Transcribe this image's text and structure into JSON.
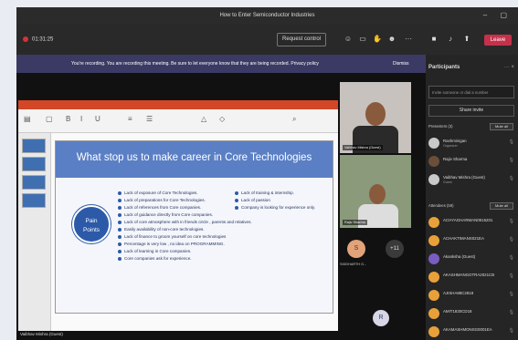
{
  "window": {
    "title": "How to Enter Semiconductor Industries",
    "controls": "– ▢"
  },
  "toolbar": {
    "timer": "01:31:25",
    "request_control": "Request control",
    "icons": [
      "people-icon",
      "chat-icon",
      "raise-hand-icon",
      "reactions-icon",
      "more-icon",
      "camera-icon",
      "mic-icon",
      "share-icon"
    ],
    "leave": "Leave",
    "leave_color": "#c4314b"
  },
  "banner": {
    "message": "You're recording. You are recording this meeting. Be sure to let everyone know that they are being recorded. Privacy policy",
    "dismiss": "Dismiss",
    "color": "#3b3a64"
  },
  "slide": {
    "title": "What stop us to make career in Core Technologies",
    "circle_line1": "Pain",
    "circle_line2": "Points",
    "bullets_left": [
      "Lack of exposure of Core Technologies.",
      "Lack of preparations for Core Technologies.",
      "Lack of references from Core companies.",
      "Lack of guidance directly from Core companies.",
      "Lack of core atmosphere with in friends circle , parents and relatives.",
      "Easily availability of non-core technologies.",
      "Lack of finance to groom yourself on core technologies",
      "Percentage is very low , no idea on PROGRAMMING.",
      "Lack of learning in Core companies.",
      "Core companies ask for experience."
    ],
    "bullets_right": [
      "Lack of training & internship.",
      "Lack of passion",
      "Company is looking for experience only."
    ],
    "accent": "#2d5aa8"
  },
  "presenter_label": "Vaibhav Mishra (Guest)",
  "tiles": {
    "tile1_name": "Vaibhav Mishra (Guest)",
    "tile2_name": "Rajiv Sharma",
    "avatar_letter": "S",
    "avatar_caption": "SIDDHARTH G...",
    "overflow": "+11",
    "avatar2_letter": "R"
  },
  "participants": {
    "title": "Participants",
    "controls": "··· ×",
    "invite_placeholder": "Invite someone or dial a number",
    "share_invite": "Share invite",
    "presenters_label": "Presenters (3)",
    "attendees_label": "Attendees (59)",
    "mute_all": "Mute all",
    "presenters": [
      {
        "name": "Rashminigan",
        "sub": "Organizer",
        "color": "#c9c9c9"
      },
      {
        "name": "Rajiv Sharma",
        "sub": "",
        "color": "#6b4e3a"
      },
      {
        "name": "Vaibhav Mishra (Guest)",
        "sub": "Guest",
        "color": "#c9c9c9"
      }
    ],
    "attendees": [
      {
        "name": "ACHYAGHARMAN0915201",
        "color": "#e8a13a"
      },
      {
        "name": "ACHAKTIMANS021EA",
        "color": "#e8a13a"
      },
      {
        "name": "Akanksha (Guest)",
        "color": "#7a5cc2"
      },
      {
        "name": "AKASHMANGOTRA2021CB",
        "color": "#e8a13a"
      },
      {
        "name": "AJISHA88C2818",
        "color": "#e8a13a"
      },
      {
        "name": "AMIT1830CD18",
        "color": "#e8a13a"
      },
      {
        "name": "AKAMASHMONSG0001EA",
        "color": "#e8a13a"
      }
    ]
  }
}
